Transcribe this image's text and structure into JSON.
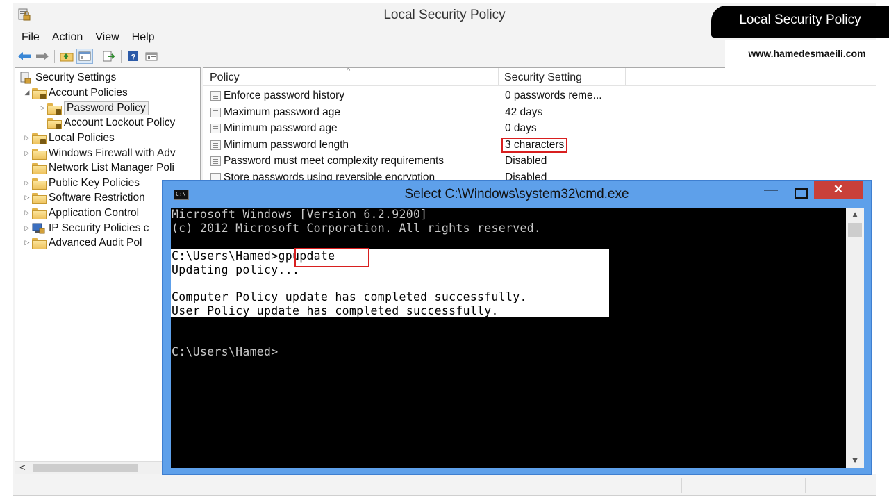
{
  "mmc": {
    "title": "Local Security Policy",
    "menu": [
      "File",
      "Action",
      "View",
      "Help"
    ],
    "toolbar_icons": [
      "back-arrow-icon",
      "forward-arrow-icon",
      "up-folder-icon",
      "show-hide-tree-icon",
      "export-list-icon",
      "help-icon",
      "properties-icon"
    ],
    "tree": {
      "root": "Security Settings",
      "items": [
        {
          "label": "Account Policies",
          "expander": "◢"
        },
        {
          "label": "Password Policy",
          "expander": "▷"
        },
        {
          "label": "Account Lockout Policy",
          "expander": ""
        },
        {
          "label": "Local Policies",
          "expander": "▷"
        },
        {
          "label": "Windows Firewall with Adv",
          "expander": "▷"
        },
        {
          "label": "Network List Manager Poli",
          "expander": ""
        },
        {
          "label": "Public Key Policies",
          "expander": "▷"
        },
        {
          "label": "Software Restriction",
          "expander": "▷"
        },
        {
          "label": "Application Control",
          "expander": "▷"
        },
        {
          "label": "IP Security Policies c",
          "expander": "▷"
        },
        {
          "label": "Advanced Audit Pol",
          "expander": "▷"
        }
      ],
      "scroll_left": "<"
    },
    "list": {
      "columns": {
        "policy": "Policy",
        "setting": "Security Setting"
      },
      "sort_indicator": "^",
      "rows": [
        {
          "name": "Enforce password history",
          "setting": "0 passwords reme..."
        },
        {
          "name": "Maximum password age",
          "setting": "42 days"
        },
        {
          "name": "Minimum password age",
          "setting": "0 days"
        },
        {
          "name": "Minimum password length",
          "setting": "3 characters"
        },
        {
          "name": "Password must meet complexity requirements",
          "setting": "Disabled"
        },
        {
          "name": "Store passwords using reversible encryption",
          "setting": "Disabled"
        }
      ]
    }
  },
  "brand": {
    "title": "Local Security Policy",
    "url": "www.hamedesmaeili.com"
  },
  "cmd": {
    "title": "Select C:\\Windows\\system32\\cmd.exe",
    "icon_text": "C:\\",
    "controls": {
      "minimize": "—",
      "close": "✕"
    },
    "lines": [
      "Microsoft Windows [Version 6.2.9200]",
      "(c) 2012 Microsoft Corporation. All rights reserved.",
      "C:\\Users\\Hamed>gpupdate",
      "Updating policy...",
      "Computer Policy update has completed successfully.",
      "User Policy update has completed successfully.",
      "C:\\Users\\Hamed>"
    ],
    "scroll_up": "▲",
    "scroll_down": "▼"
  },
  "colors": {
    "highlight_red": "#d81f1f",
    "cmd_border": "#5ea0ea",
    "cmd_close": "#c9403a",
    "console_bg": "#000000",
    "console_text": "#c8c8c8"
  }
}
